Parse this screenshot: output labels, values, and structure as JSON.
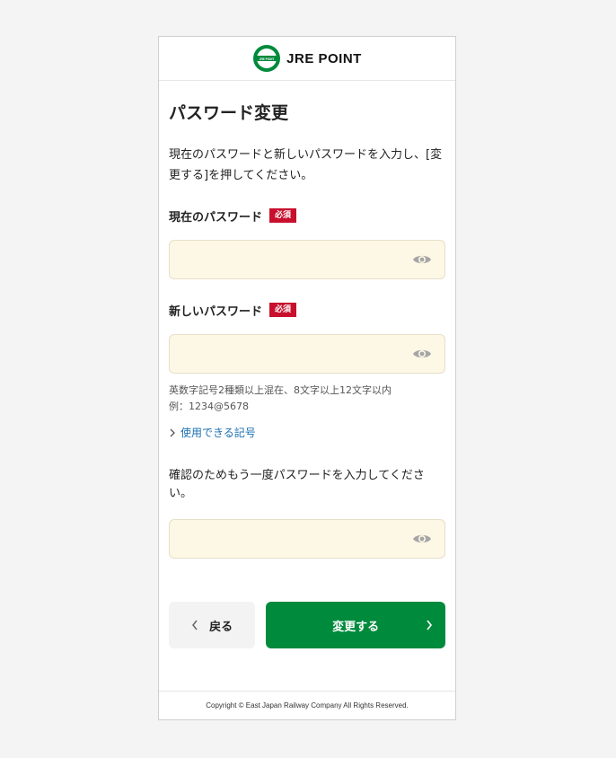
{
  "header": {
    "brand": "JRE POINT",
    "logo_icon": "jre-point-logo-icon",
    "logo_text": "JRE POINT",
    "brand_color": "#008a3c"
  },
  "page": {
    "title": "パスワード変更",
    "description": "現在のパスワードと新しいパスワードを入力し、[変更する]を押してください。"
  },
  "current_password": {
    "label": "現在のパスワード",
    "required_badge": "必須",
    "value": "",
    "toggle_icon": "eye-icon"
  },
  "new_password": {
    "label": "新しいパスワード",
    "required_badge": "必須",
    "value": "",
    "help_line1": "英数字記号2種類以上混在、8文字以上12文字以内",
    "help_line2": "例：1234@5678",
    "usable_symbols_link": "使用できる記号",
    "toggle_icon": "eye-icon"
  },
  "confirm_password": {
    "instruction": "確認のためもう一度パスワードを入力してください。",
    "value": "",
    "toggle_icon": "eye-icon"
  },
  "actions": {
    "back_label": "戻る",
    "submit_label": "変更する"
  },
  "footer": {
    "copyright": "Copyright © East Japan Railway Company All Rights Reserved."
  },
  "colors": {
    "accent": "#008a3c",
    "required": "#c8102e",
    "input_bg": "#fdf7e6",
    "link": "#1a6fb0"
  }
}
